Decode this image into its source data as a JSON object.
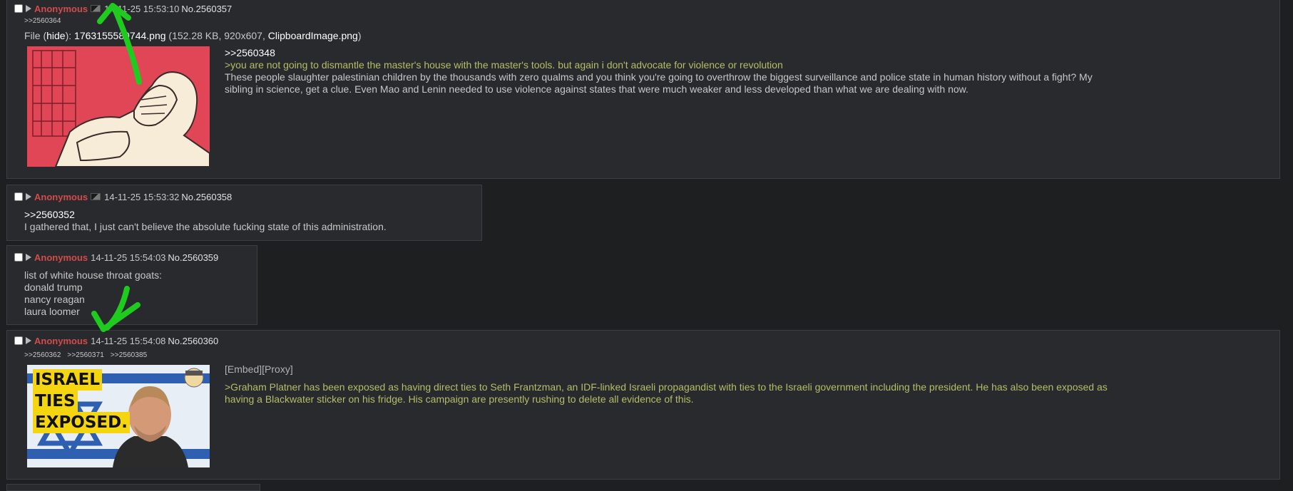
{
  "posts": [
    {
      "name": "Anonymous",
      "date": "14-11-25 15:53:10",
      "number": "No.2560357",
      "backlinks": [
        ">>2560364"
      ],
      "file": {
        "prefix": "File (",
        "hide": "hide",
        "mid": "): ",
        "filename": "1763155589744.png",
        "meta": " (152.28 KB, 920x607, ",
        "original": "ClipboardImage.png",
        "suffix": ")"
      },
      "quote_link": ">>2560348",
      "greentext": ">you are not going to dismantle the master's house with the master's tools. but again i don't advocate for violence or revolution",
      "text_lines": [
        "These people slaughter palestinian children by the thousands with zero qualms and you think you're going to overthrow the biggest surveillance and police state in human history without a fight? My",
        "sibling in science, get a clue. Even Mao and Lenin needed to use violence against states that were much weaker and less developed than what we are dealing with now."
      ]
    },
    {
      "name": "Anonymous",
      "date": "14-11-25 15:53:32",
      "number": "No.2560358",
      "quote_link": ">>2560352",
      "text_lines": [
        "I gathered that, I just can't believe the absolute fucking state of this administration."
      ]
    },
    {
      "name": "Anonymous",
      "date": "14-11-25 15:54:03",
      "number": "No.2560359",
      "text_lines": [
        "list of white house throat goats:",
        "donald trump",
        "nancy reagan",
        "laura loomer"
      ]
    },
    {
      "name": "Anonymous",
      "date": "14-11-25 15:54:08",
      "number": "No.2560360",
      "backlinks": [
        ">>2560362",
        ">>2560371",
        ">>2560385"
      ],
      "embed_label": "[Embed][Proxy]",
      "thumbnail_text": [
        "ISRAEL",
        "TIES",
        "EXPOSED."
      ],
      "greentext_lines": [
        ">Graham Platner has been exposed as having direct ties to Seth Frantzman, an IDF-linked Israeli propagandist with ties to the Israeli government including the president. He has also been exposed as",
        "having a Blackwater sticker on his fridge. His campaign are presently rushing to delete all evidence of this."
      ]
    }
  ],
  "colors": {
    "background": "#1d1f21",
    "post_bg": "#282a2e",
    "name": "#d34b4b",
    "greentext": "#b5bd68",
    "text": "#c5c8c6",
    "annotation": "#22cc22"
  }
}
